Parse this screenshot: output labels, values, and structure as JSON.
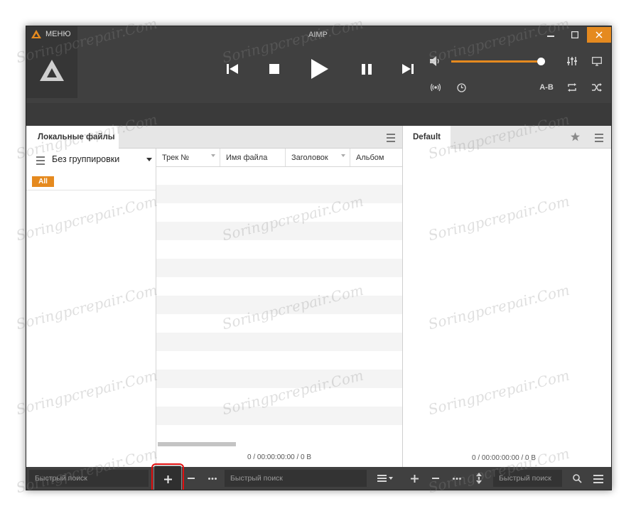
{
  "window": {
    "title": "AIMP",
    "menu_label": "МЕНЮ"
  },
  "colors": {
    "accent": "#e58a1f",
    "dark_bg": "#404040",
    "highlight_box": "#e01010"
  },
  "library": {
    "tab_label": "Локальные файлы",
    "grouping_label": "Без группировки",
    "all_badge": "All",
    "columns": [
      "Трек №",
      "Имя файла",
      "Заголовок",
      "Альбом"
    ],
    "status": "0 / 00:00:00:00 / 0 B",
    "search_placeholder": "Быстрый поиск"
  },
  "playlist": {
    "tab_label": "Default",
    "status": "0 / 00:00:00:00 / 0 B",
    "search_placeholder": "Быстрый поиск"
  },
  "library_search": {
    "placeholder": "Быстрый поиск"
  },
  "controls": {
    "ab_label": "A-B"
  },
  "volume": {
    "level": 0.97
  },
  "icons": {
    "logo": "aimp-logo-icon",
    "minimize": "minimize-icon",
    "maximize": "maximize-icon",
    "close": "close-icon",
    "add": "plus-icon",
    "remove": "minus-icon",
    "more": "ellipsis-icon"
  },
  "watermark_text": "Soringpcrepair.Com"
}
